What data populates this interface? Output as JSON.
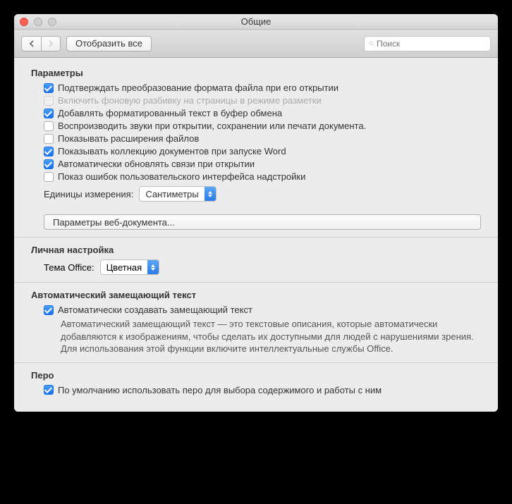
{
  "window": {
    "title": "Общие"
  },
  "toolbar": {
    "show_all": "Отобразить все",
    "search_placeholder": "Поиск"
  },
  "params": {
    "heading": "Параметры",
    "items": [
      {
        "label": "Подтверждать преобразование формата файла при его открытии",
        "checked": true,
        "disabled": false
      },
      {
        "label": "Включить фоновую разбивку на страницы в режиме разметки",
        "checked": false,
        "disabled": true
      },
      {
        "label": "Добавлять форматированный текст в буфер обмена",
        "checked": true,
        "disabled": false
      },
      {
        "label": "Воспроизводить звуки при открытии, сохранении или печати документа.",
        "checked": false,
        "disabled": false
      },
      {
        "label": "Показывать расширения файлов",
        "checked": false,
        "disabled": false
      },
      {
        "label": "Показывать коллекцию документов при запуске Word",
        "checked": true,
        "disabled": false
      },
      {
        "label": "Автоматически обновлять связи при открытии",
        "checked": true,
        "disabled": false
      },
      {
        "label": "Показ ошибок пользовательского интерфейса надстройки",
        "checked": false,
        "disabled": false
      }
    ],
    "units_label": "Единицы измерения:",
    "units_value": "Сантиметры",
    "web_doc_button": "Параметры веб-документа..."
  },
  "personal": {
    "heading": "Личная настройка",
    "theme_label": "Тема Office:",
    "theme_value": "Цветная"
  },
  "alt_text": {
    "heading": "Автоматический замещающий текст",
    "checkbox_label": "Автоматически создавать замещающий текст",
    "checked": true,
    "description": "Автоматический замещающий текст — это текстовые описания, которые автоматически добавляются к изображениям, чтобы сделать их доступными для людей с нарушениями зрения. Для использования этой функции включите интеллектуальные службы Office."
  },
  "pen": {
    "heading": "Перо",
    "checkbox_label": "По умолчанию использовать перо для выбора содержимого и работы с ним",
    "checked": true
  }
}
